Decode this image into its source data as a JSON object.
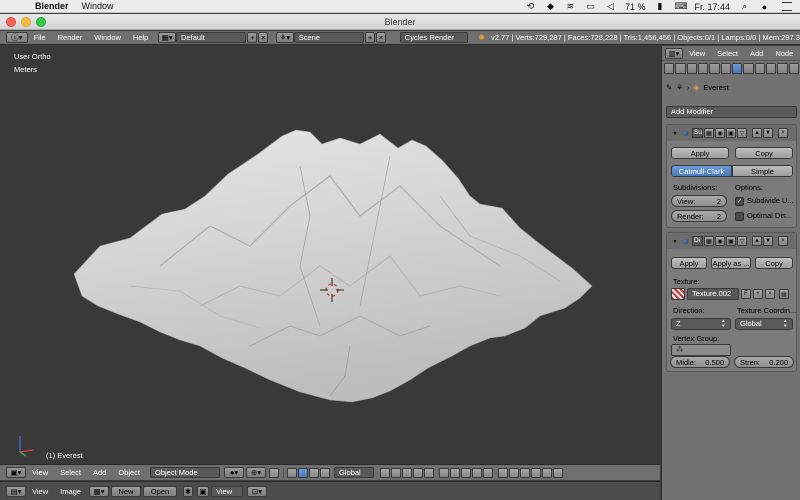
{
  "macos": {
    "app_name": "Blender",
    "menu": [
      "Window"
    ],
    "battery": "71 %",
    "clock": "Fr. 17:44"
  },
  "window": {
    "title": "Blender"
  },
  "info_header": {
    "menus": [
      "File",
      "Render",
      "Window",
      "Help"
    ],
    "layout": "Default",
    "scene": "Scene",
    "engine": "Cycles Render",
    "stats": "v2.77 | Verts:729,287 | Faces:728,228 | Tris:1,456,456 | Objects:0/1 | Lamps:0/0 | Mem:297.3"
  },
  "viewport": {
    "view_name": "User Ortho",
    "units": "Meters",
    "object_label": "(1) Everest",
    "header_menus": [
      "View",
      "Select",
      "Add",
      "Object"
    ],
    "mode": "Object Mode",
    "orientation": "Global"
  },
  "image_editor": {
    "menus": [
      "View",
      "Image"
    ],
    "new_label": "New",
    "open_label": "Open",
    "view_label": "View"
  },
  "properties": {
    "header_menus": [
      "View",
      "Select",
      "Add",
      "Node"
    ],
    "object_name": "Everest",
    "add_modifier": "Add Modifier",
    "subsurf": {
      "name": "Su",
      "apply": "Apply",
      "copy": "Copy",
      "type_a": "Catmull-Clark",
      "type_b": "Simple",
      "subdivisions_label": "Subdivisions:",
      "options_label": "Options:",
      "view_label": "View:",
      "view_value": "2",
      "render_label": "Render:",
      "render_value": "2",
      "subdivide_uv": "Subdivide U...",
      "optimal_display": "Optimal Dis..."
    },
    "displace": {
      "name": "Di",
      "apply": "Apply",
      "apply_as": "Apply as ...",
      "copy": "Copy",
      "texture_label": "Texture:",
      "texture_name": "Texture.002",
      "texture_flag": "F",
      "direction_label": "Direction:",
      "direction_value": "Z",
      "coords_label": "Texture Coordin...",
      "coords_value": "Global",
      "vertex_group_label": "Vertex Group:",
      "midlevel_label": "Midle:",
      "midlevel_value": "0.500",
      "strength_label": "Stren:",
      "strength_value": "0.200"
    }
  },
  "colors": {
    "accent_blue": "#5680c2",
    "viewport_bg": "#393939",
    "panel_bg": "#727272"
  }
}
